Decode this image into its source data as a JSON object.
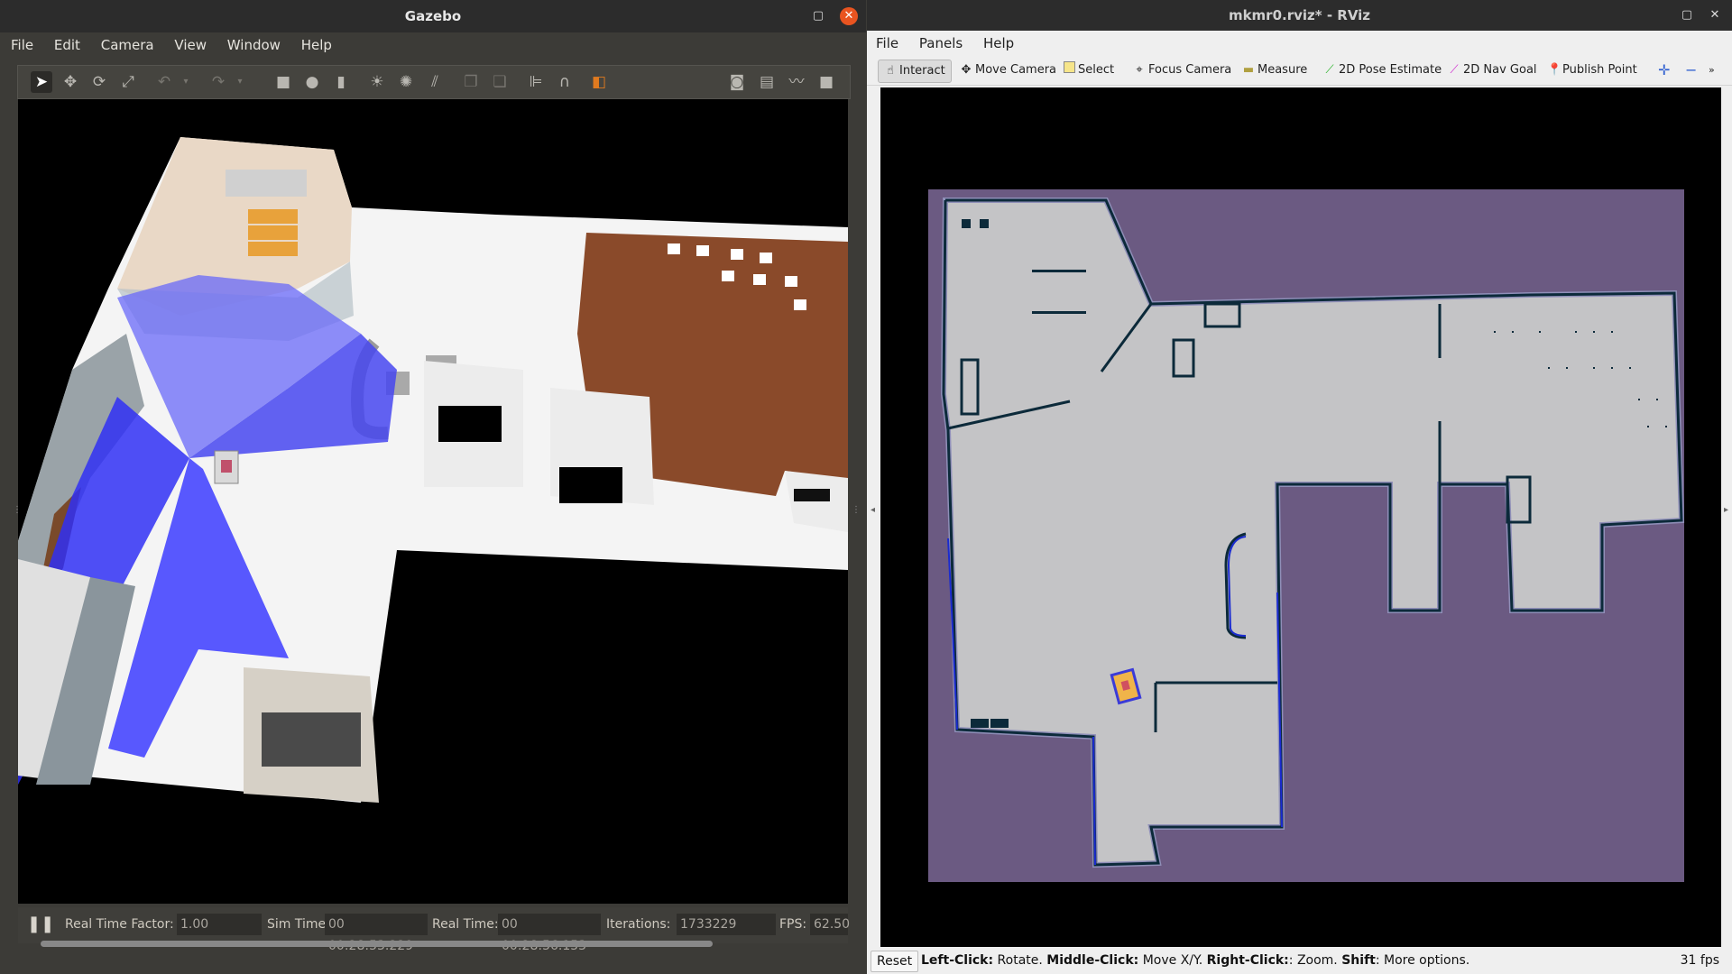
{
  "gazebo": {
    "title": "Gazebo",
    "menu": [
      "File",
      "Edit",
      "Camera",
      "View",
      "Window",
      "Help"
    ],
    "toolbar_icons": [
      "select-arrow-icon",
      "translate-icon",
      "rotate-icon",
      "scale-icon",
      "undo-icon",
      "undo-dropdown-icon",
      "redo-icon",
      "redo-dropdown-icon",
      "box-shape-icon",
      "sphere-shape-icon",
      "cylinder-shape-icon",
      "point-light-icon",
      "spot-light-icon",
      "directional-light-icon",
      "copy-icon",
      "paste-icon",
      "align-icon",
      "snap-icon",
      "view-angle-icon",
      "screenshot-icon",
      "log-icon",
      "plot-icon",
      "video-record-icon"
    ],
    "status": {
      "real_time_factor_label": "Real Time Factor:",
      "real_time_factor": "1.00",
      "sim_time_label": "Sim Time:",
      "sim_time": "00 00:28:53.229",
      "real_time_label": "Real Time:",
      "real_time": "00 00:28:56.153",
      "iterations_label": "Iterations:",
      "iterations": "1733229",
      "fps_label": "FPS:",
      "fps": "62.50"
    }
  },
  "rviz": {
    "title": "mkmr0.rviz* - RViz",
    "menu": [
      "File",
      "Panels",
      "Help"
    ],
    "tools": [
      {
        "label": "Interact",
        "icon": "hand-icon",
        "active": true
      },
      {
        "label": "Move Camera",
        "icon": "move-camera-icon",
        "active": false
      },
      {
        "label": "Select",
        "icon": "select-rect-icon",
        "active": false
      },
      {
        "label": "Focus Camera",
        "icon": "focus-icon",
        "active": false
      },
      {
        "label": "Measure",
        "icon": "ruler-icon",
        "active": false
      },
      {
        "label": "2D Pose Estimate",
        "icon": "pose-arrow-icon",
        "active": false
      },
      {
        "label": "2D Nav Goal",
        "icon": "goal-arrow-icon",
        "active": false
      },
      {
        "label": "Publish Point",
        "icon": "pin-icon",
        "active": false
      }
    ],
    "status": {
      "reset_label": "Reset",
      "help_parts": [
        {
          "b": "Left-Click:",
          "t": " Rotate. "
        },
        {
          "b": "Middle-Click:",
          "t": " Move X/Y. "
        },
        {
          "b": "Right-Click:",
          "t": ": Zoom. "
        },
        {
          "b": "Shift",
          "t": ": More options."
        }
      ],
      "fps": "31 fps"
    }
  },
  "colors": {
    "ubuntu_orange": "#e95420",
    "map_unknown": "#6b5a82",
    "map_free": "#c3c3c3",
    "laser_blue": "#3b3bff"
  }
}
